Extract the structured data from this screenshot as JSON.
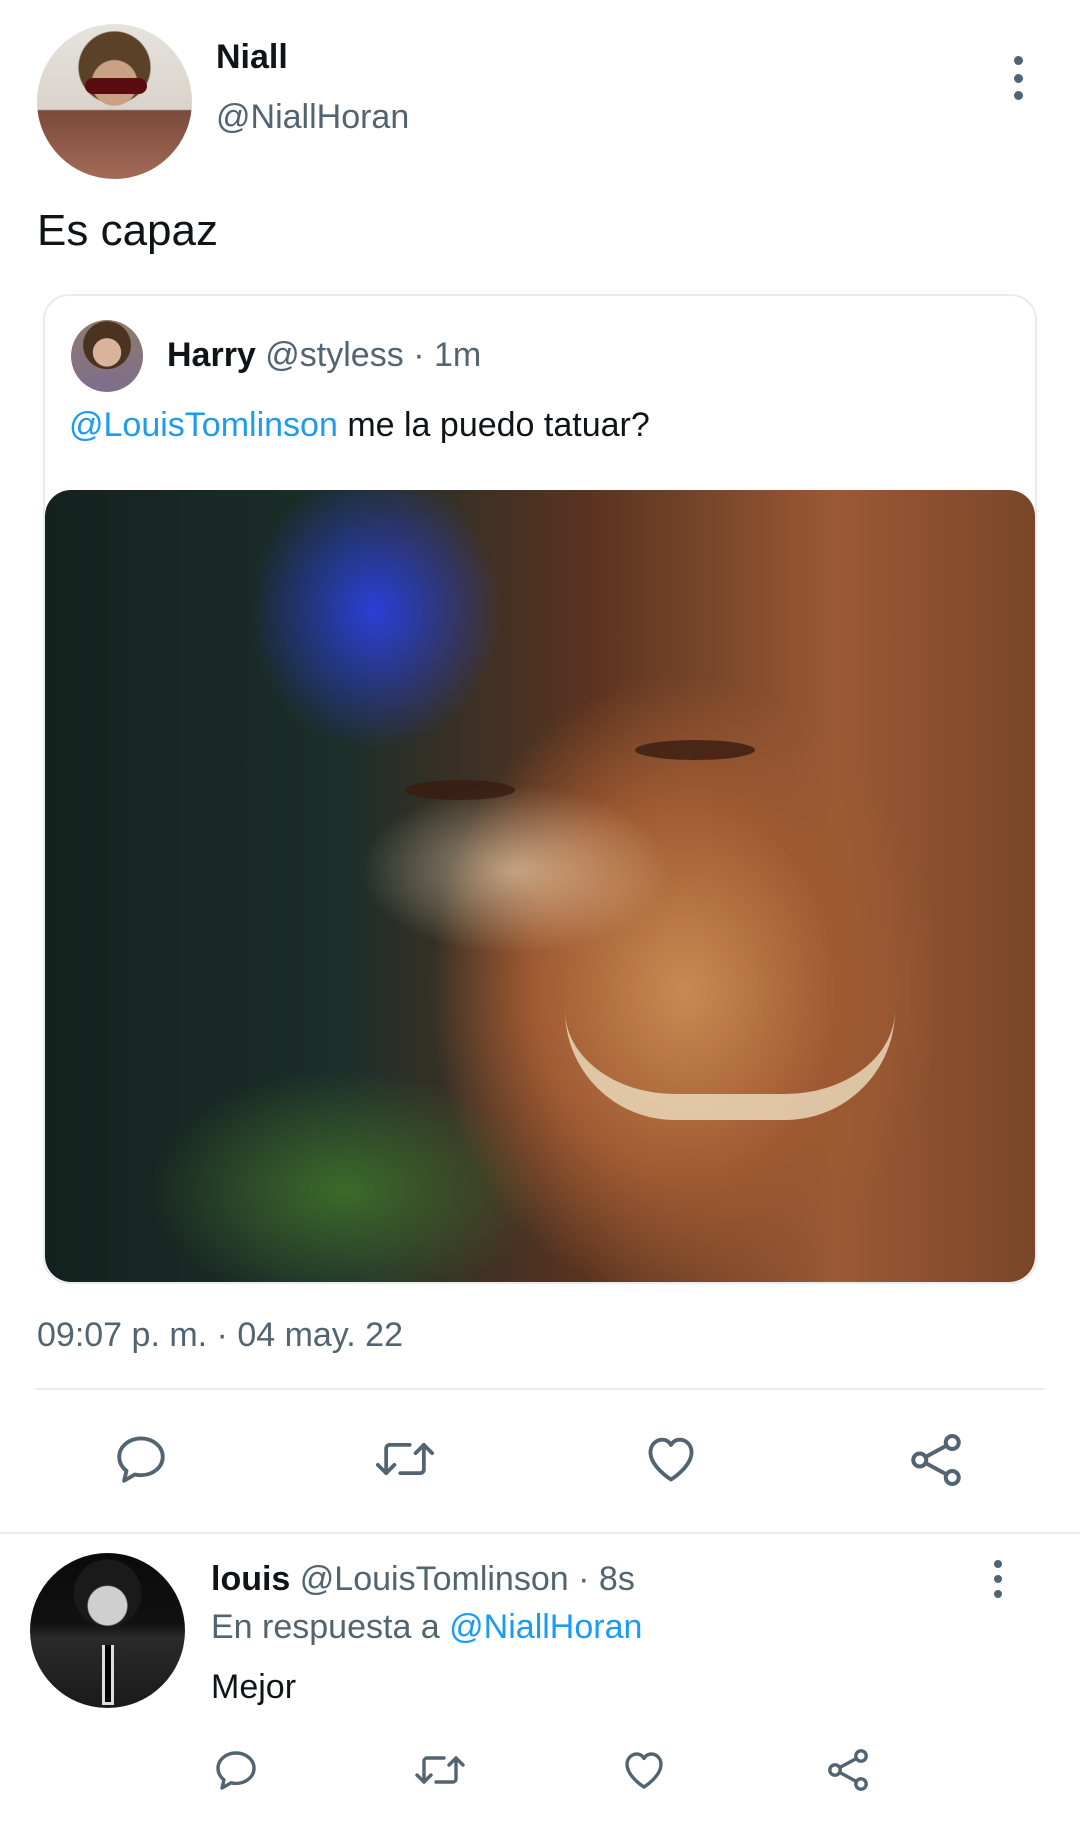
{
  "main_tweet": {
    "display_name": "Niall",
    "handle": "@NiallHoran",
    "text": "Es capaz",
    "timestamp": "09:07 p. m. · 04 may. 22",
    "avatar_icon": "profile-photo"
  },
  "quoted_tweet": {
    "display_name": "Harry",
    "handle": "@styless",
    "separator": "·",
    "time_ago": "1m",
    "mention": "@LouisTomlinson",
    "text": "me la puedo tatuar?",
    "media": "photo"
  },
  "actions": {
    "icons": [
      "reply-icon",
      "retweet-icon",
      "like-icon",
      "share-icon"
    ],
    "color": "#536471"
  },
  "reply_tweet": {
    "display_name": "louis",
    "handle": "@LouisTomlinson",
    "separator": "·",
    "time_ago": "8s",
    "replying_label": "En respuesta a",
    "replying_to": "@NiallHoran",
    "text": "Mejor"
  },
  "colors": {
    "accent": "#1d9bf0",
    "secondary_text": "#536471",
    "border": "#e6ecf0"
  }
}
